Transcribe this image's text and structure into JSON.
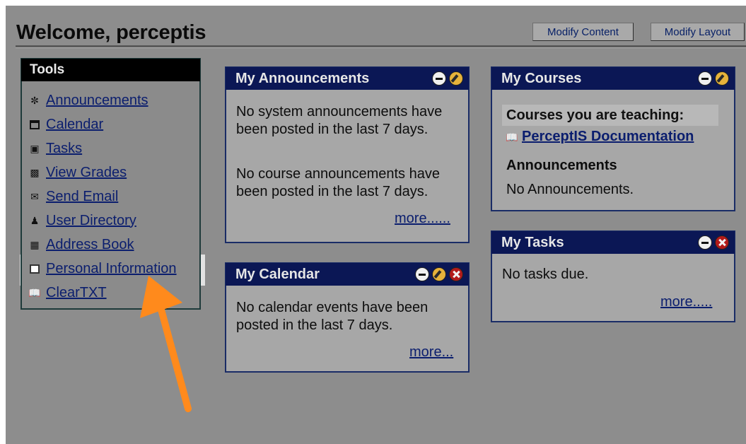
{
  "header": {
    "welcome": "Welcome, perceptis",
    "modify_content": "Modify Content",
    "modify_layout": "Modify Layout"
  },
  "tools": {
    "title": "Tools",
    "items": [
      {
        "label": "Announcements",
        "icon": "announcement-icon"
      },
      {
        "label": "Calendar",
        "icon": "calendar-icon"
      },
      {
        "label": "Tasks",
        "icon": "tasks-icon"
      },
      {
        "label": "View Grades",
        "icon": "grades-icon"
      },
      {
        "label": "Send Email",
        "icon": "email-icon"
      },
      {
        "label": "User Directory",
        "icon": "user-directory-icon"
      },
      {
        "label": "Address Book",
        "icon": "address-book-icon"
      },
      {
        "label": "Personal Information",
        "icon": "personal-information-icon"
      },
      {
        "label": "ClearTXT",
        "icon": "book-icon"
      }
    ]
  },
  "announcements": {
    "title": "My Announcements",
    "system_text": "No system announcements have been posted in the last 7 days.",
    "course_text": "No course announcements have been posted in the last 7 days.",
    "more": "more",
    "more_dots": "......"
  },
  "calendar": {
    "title": "My Calendar",
    "text": "No calendar events have been posted in the last 7 days.",
    "more": "more..."
  },
  "courses": {
    "title": "My Courses",
    "teaching_label": "Courses you are teaching:",
    "course_name": "PerceptIS Documentation",
    "announcements_label": "Announcements",
    "announcements_text": "No Announcements."
  },
  "tasks": {
    "title": "My Tasks",
    "text": "No tasks due.",
    "more": "more",
    "more_dots": "....."
  },
  "colors": {
    "background": "#8d8d8d",
    "module_header": "#0b1755",
    "link": "#0b1e6e",
    "highlight": "#e2e2e2",
    "arrow": "#ff8a1c"
  }
}
